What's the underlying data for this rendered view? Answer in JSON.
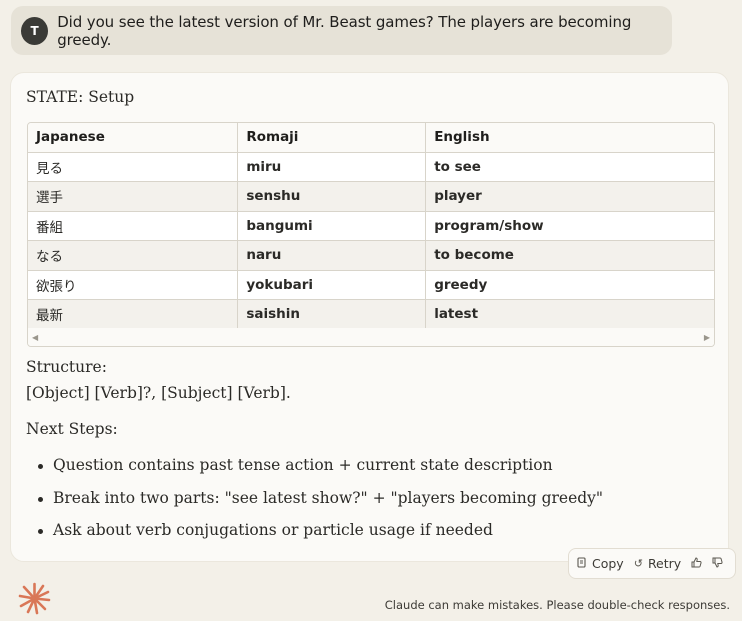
{
  "user": {
    "avatar_initial": "T",
    "message": "Did you see the latest version of Mr. Beast games? The players are becoming greedy."
  },
  "response": {
    "state_line": "STATE: Setup",
    "table": {
      "headers": [
        "Japanese",
        "Romaji",
        "English"
      ],
      "rows": [
        [
          "見る",
          "miru",
          "to see"
        ],
        [
          "選手",
          "senshu",
          "player"
        ],
        [
          "番組",
          "bangumi",
          "program/show"
        ],
        [
          "なる",
          "naru",
          "to become"
        ],
        [
          "欲張り",
          "yokubari",
          "greedy"
        ],
        [
          "最新",
          "saishin",
          "latest"
        ]
      ]
    },
    "structure_label": "Structure:",
    "structure_text": "[Object] [Verb]?, [Subject] [Verb].",
    "next_steps_label": "Next Steps:",
    "next_steps": [
      "Question contains past tense action + current state description",
      "Break into two parts: \"see latest show?\" + \"players becoming greedy\"",
      "Ask about verb conjugations or particle usage if needed"
    ]
  },
  "actions": {
    "copy_label": "Copy",
    "retry_label": "Retry"
  },
  "footer": {
    "disclaimer": "Claude can make mistakes. Please double-check responses."
  },
  "colors": {
    "background": "#f3f0e8",
    "accent_logo": "#d97757"
  },
  "icons": [
    "copy-icon",
    "retry-icon",
    "thumbs-up-icon",
    "thumbs-down-icon",
    "claude-logo-icon"
  ]
}
